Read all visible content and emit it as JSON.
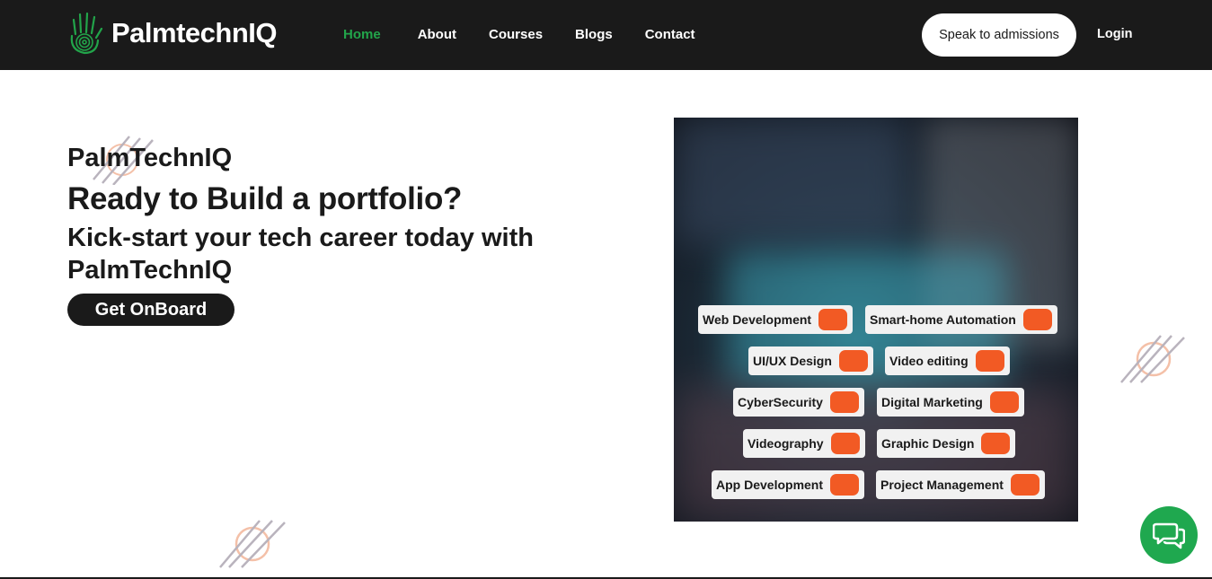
{
  "header": {
    "logo_text": "PalmtechnIQ",
    "nav": [
      "Home",
      "About",
      "Courses",
      "Blogs",
      "Contact"
    ],
    "active": "Home",
    "speak_button": "Speak to admissions",
    "login": "Login"
  },
  "hero": {
    "brand": "PalmTechnIQ",
    "headline": "Ready to Build a portfolio?",
    "subline": "Kick-start your tech career today with PalmTechnIQ",
    "cta": "Get OnBoard"
  },
  "courses": [
    "Web Development",
    "Smart-home Automation",
    "UI/UX Design",
    "Video editing",
    "CyberSecurity",
    "Digital Marketing",
    "Videography",
    "Graphic Design",
    "App Development",
    "Project Management"
  ],
  "colors": {
    "brand_green": "#22a44a",
    "accent_orange": "#f25a24",
    "dark": "#1a1a1a"
  },
  "icons": {
    "logo": "palm-hand-icon",
    "chat": "chat-bubble-icon"
  }
}
